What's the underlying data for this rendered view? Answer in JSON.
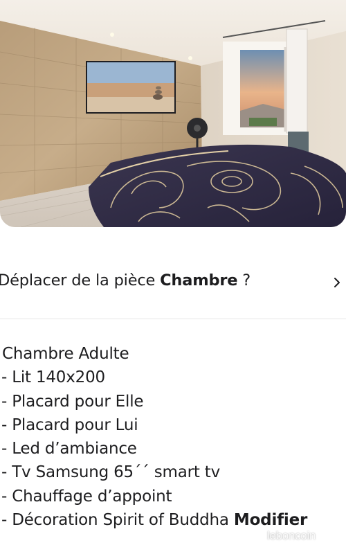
{
  "photo": {
    "alt": "Chambre"
  },
  "move": {
    "prefix": "Déplacer de la pièce ",
    "room": "Chambre",
    "suffix": " ?"
  },
  "description": {
    "title": "Chambre Adulte",
    "items": [
      "- Lit 140x200",
      "- Placard pour Elle",
      "- Placard pour Lui",
      "- Led d’ambiance",
      "- Tv Samsung 65´´ smart tv",
      "- Chauffage d’appoint",
      "- Décoration Spirit of Buddha "
    ],
    "modify_label": "Modifier"
  },
  "watermark": "leboncoin"
}
